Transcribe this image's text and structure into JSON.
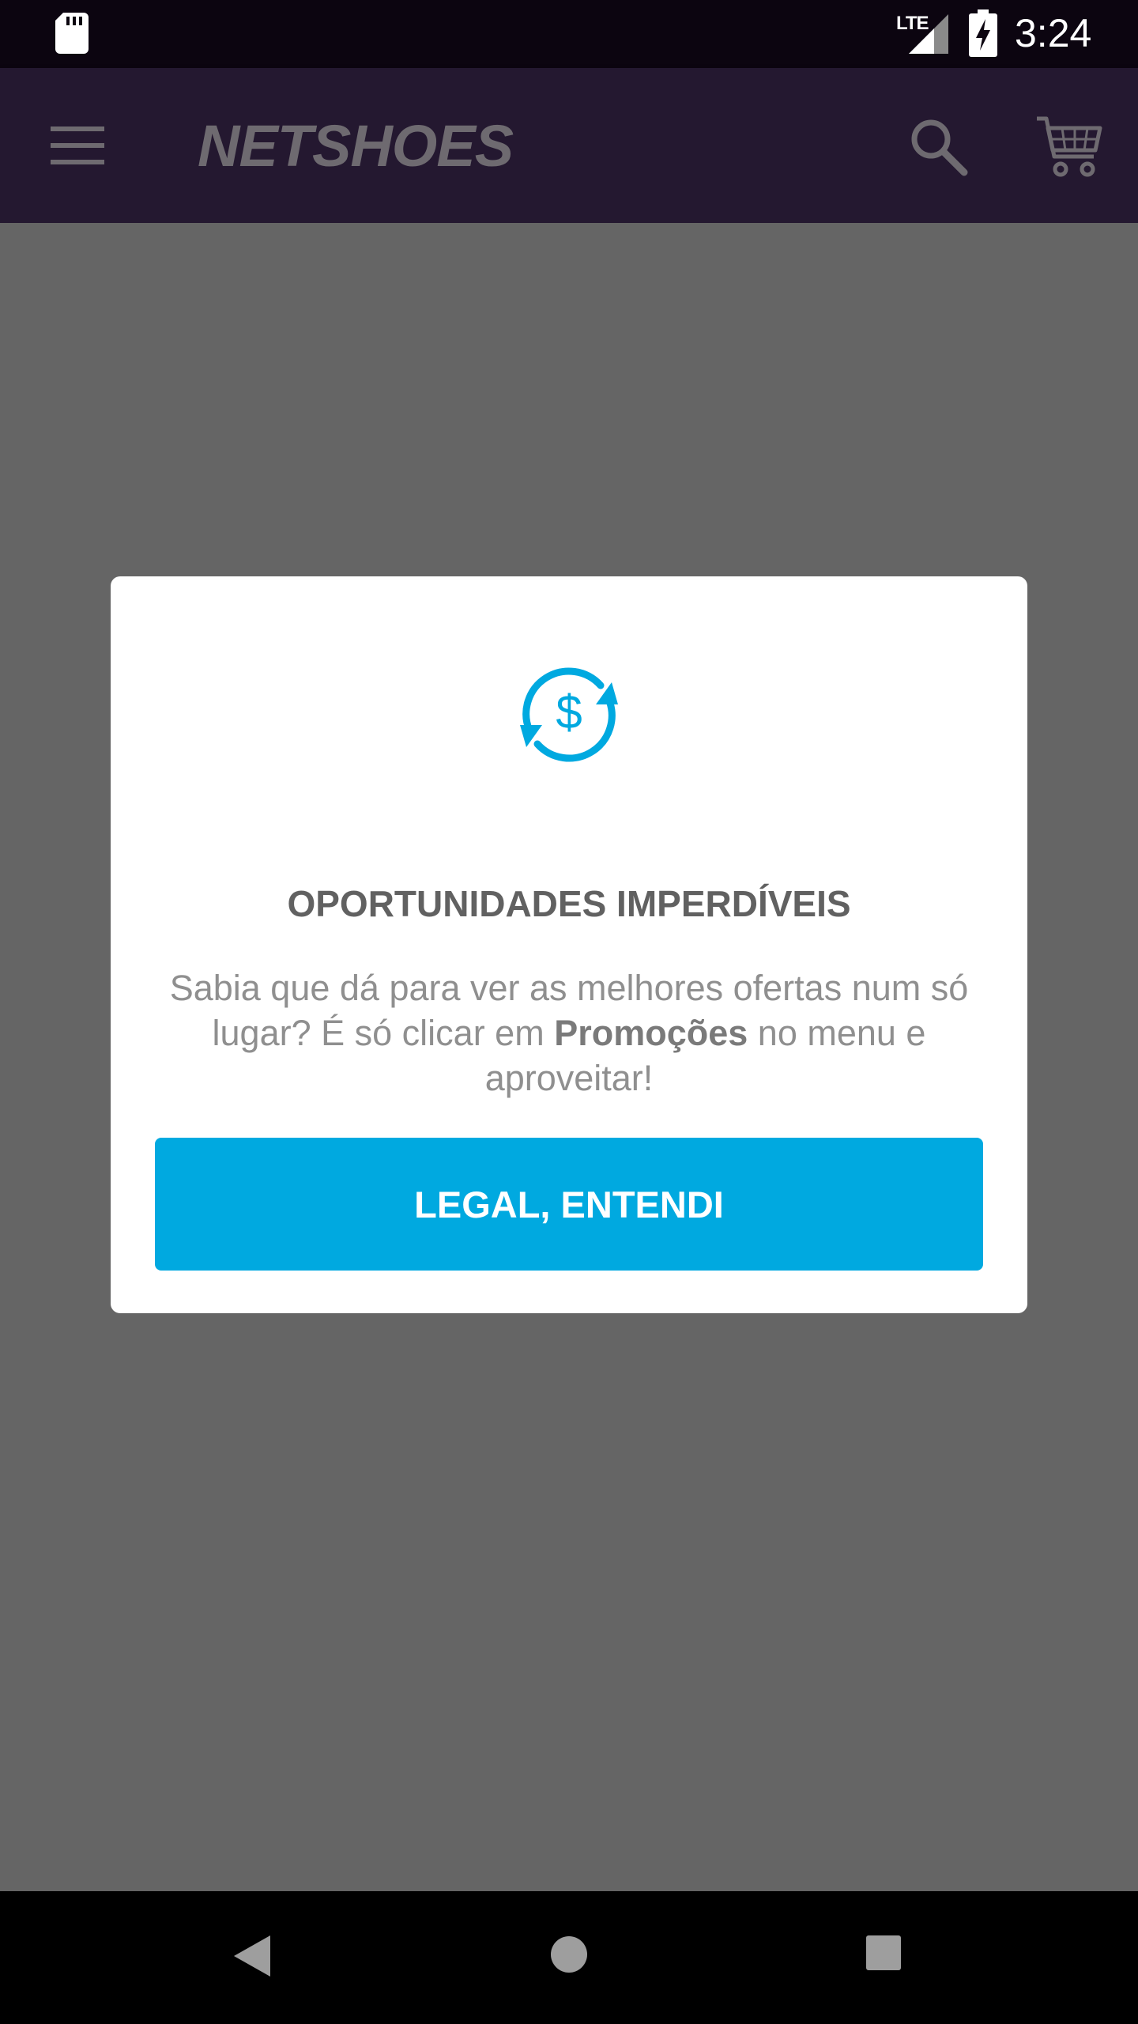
{
  "status_bar": {
    "time": "3:24",
    "network": "LTE",
    "icons": [
      "sd-card-icon",
      "signal-icon",
      "battery-charging-icon"
    ]
  },
  "app_bar": {
    "logo": "NETSHOES",
    "icons": [
      "menu-icon",
      "search-icon",
      "cart-icon"
    ]
  },
  "dialog": {
    "icon": "currency-exchange-icon",
    "title": "OPORTUNIDADES IMPERDÍVEIS",
    "body_before": "Sabia que dá para ver as melhores ofertas num só lugar? É só clicar em ",
    "body_bold": "Promoções",
    "body_after": " no menu e aproveitar!",
    "button_label": "LEGAL, ENTENDI"
  },
  "nav_bar": {
    "icons": [
      "back-icon",
      "home-icon",
      "recents-icon"
    ]
  },
  "colors": {
    "accent": "#00a9e0",
    "app_bar": "#241830",
    "scrim": "#656565",
    "status_bar": "#0c0510"
  }
}
